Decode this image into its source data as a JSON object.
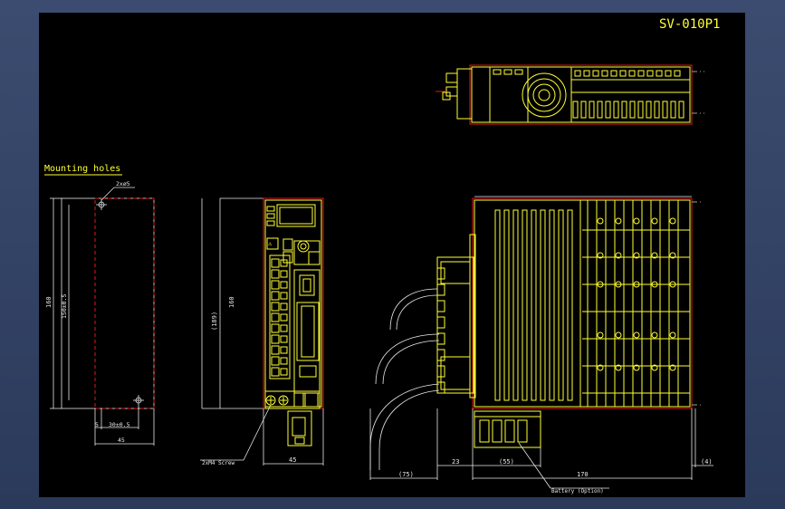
{
  "drawing": {
    "title": "SV-010P1",
    "mounting_label": "Mounting holes",
    "hole_callout": "2xø5",
    "dim_160_left": "160",
    "dim_150": "150±0.5",
    "dim_5": "5",
    "dim_30": "30±0.5",
    "dim_45_left": "45",
    "dim_189": "(189)",
    "dim_160_front": "160",
    "screw_callout": "2xM4 Screw",
    "dim_45_front": "45",
    "dim_75": "(75)",
    "dim_23": "23",
    "dim_55": "(55)",
    "dim_170": "170",
    "dim_4": "(4)",
    "battery_callout": "Battery (Option)"
  },
  "colors": {
    "outline": "#ffff33",
    "border": "#e01818",
    "dimension": "#e8e8e8",
    "background": "#000000"
  }
}
